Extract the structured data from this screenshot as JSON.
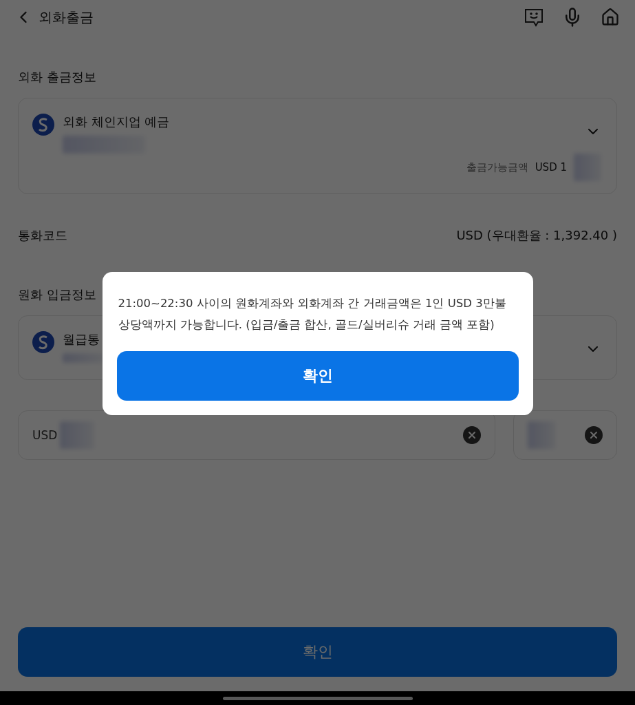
{
  "header": {
    "title": "외화출금"
  },
  "withdraw_info": {
    "title": "외화 출금정보",
    "account": {
      "name": "외화 체인지업 예금",
      "available_label": "출금가능금액",
      "available_value": "USD 1"
    }
  },
  "currency": {
    "label": "통화코드",
    "value": "USD (우대환율 : 1,392.40 )"
  },
  "deposit_info": {
    "title": "원화 입금정보",
    "account": {
      "name": "월급통"
    }
  },
  "amount_field": {
    "value": "USD"
  },
  "dialog": {
    "message": "21:00~22:30 사이의 원화계좌와 외화계좌 간 거래금액은 1인 USD 3만불 상당액까지 가능합니다. (입금/출금 합산, 골드/실버리슈 거래 금액 포함)",
    "button": "확인"
  },
  "bottom_button": "확인"
}
